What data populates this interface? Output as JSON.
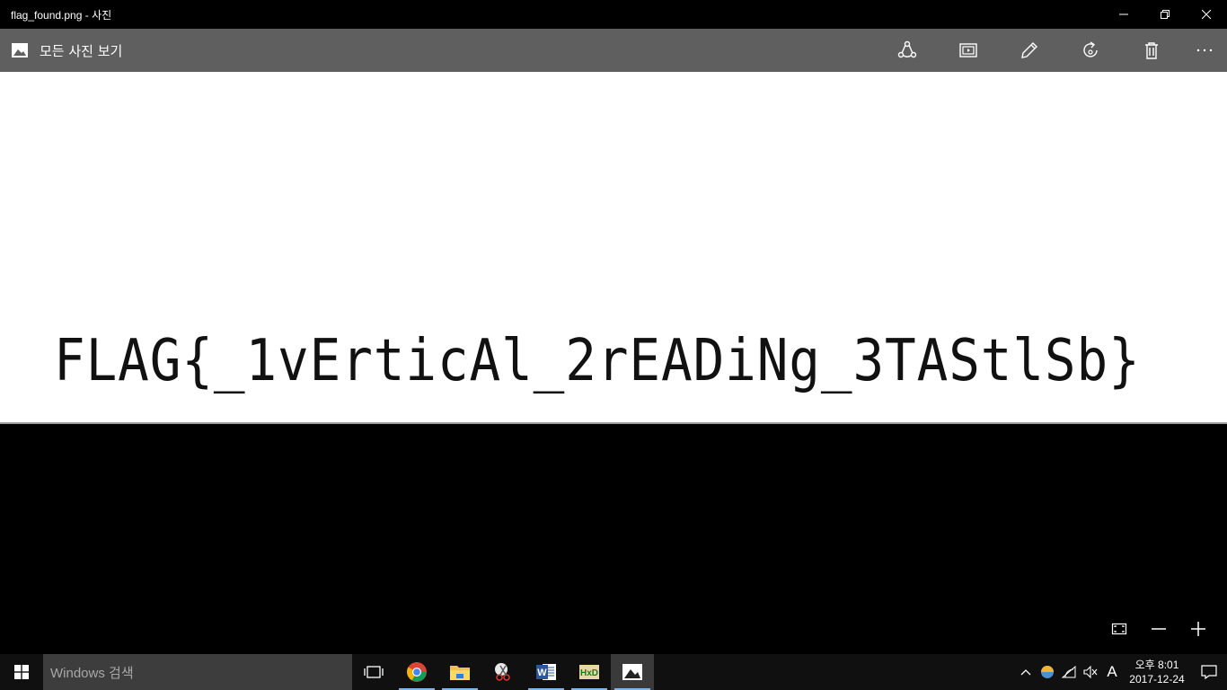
{
  "window": {
    "title": "flag_found.png - 사진"
  },
  "toolbar": {
    "back_label": "모든 사진 보기",
    "buttons": [
      "share-icon",
      "slideshow-icon",
      "edit-icon",
      "rotate-icon",
      "delete-icon",
      "more-icon"
    ]
  },
  "image": {
    "text": "FLAG{_1vErticAl_2rEADiNg_3TAStlSb}"
  },
  "taskbar": {
    "search_placeholder": "Windows 검색",
    "clock": {
      "time": "오후 8:01",
      "date": "2017-12-24"
    },
    "ime_label": "A"
  },
  "colors": {
    "toolbar_bg": "#5f5f5f",
    "taskbar_bg": "#101010",
    "accent_underline": "#7fb2e5"
  }
}
